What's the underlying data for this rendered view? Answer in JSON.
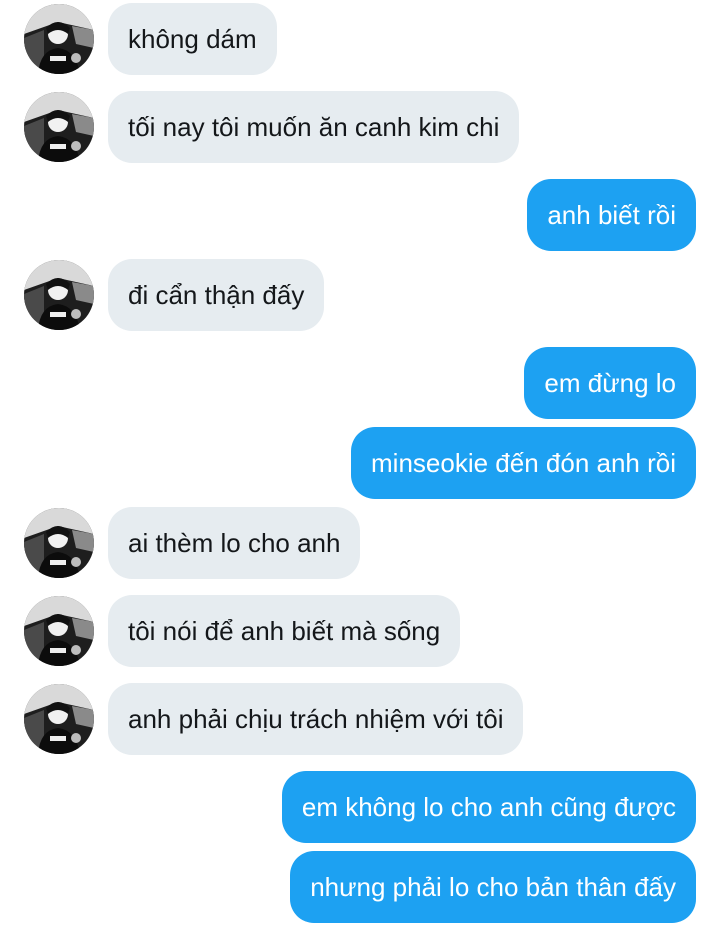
{
  "conversation": {
    "messages": [
      {
        "direction": "incoming",
        "text": "không dám",
        "avatar": "user-avatar"
      },
      {
        "direction": "incoming",
        "text": "tối nay tôi muốn ăn canh kim chi",
        "avatar": "user-avatar"
      },
      {
        "direction": "outgoing",
        "text": "anh biết rồi"
      },
      {
        "direction": "incoming",
        "text": "đi cẩn thận đấy",
        "avatar": "user-avatar"
      },
      {
        "direction": "outgoing",
        "text": "em đừng lo"
      },
      {
        "direction": "outgoing",
        "text": "minseokie đến đón anh rồi"
      },
      {
        "direction": "incoming",
        "text": "ai thèm lo cho anh",
        "avatar": "user-avatar"
      },
      {
        "direction": "incoming",
        "text": "tôi nói để anh biết mà sống",
        "avatar": "user-avatar"
      },
      {
        "direction": "incoming",
        "text": "anh phải chịu trách nhiệm với tôi",
        "avatar": "user-avatar"
      },
      {
        "direction": "outgoing",
        "text": "em không lo cho anh cũng được"
      },
      {
        "direction": "outgoing",
        "text": "nhưng phải lo cho bản thân đấy"
      }
    ]
  },
  "colors": {
    "incoming_bubble": "#e6ecf0",
    "incoming_text": "#14171a",
    "outgoing_bubble": "#1da1f2",
    "outgoing_text": "#ffffff"
  }
}
